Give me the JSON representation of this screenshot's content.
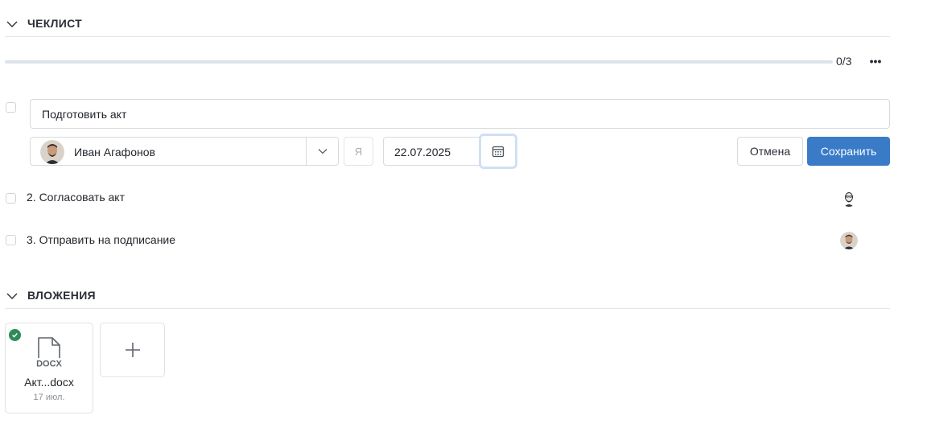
{
  "checklist": {
    "title": "ЧЕКЛИСТ",
    "progress_text": "0/3",
    "progress_fraction": 0,
    "more_icon": "ellipsis-icon",
    "edit_item": {
      "text_value": "Подготовить акт",
      "assignee_name": "Иван Агафонов",
      "me_label": "Я",
      "date_value": "22.07.2025",
      "cancel_label": "Отмена",
      "save_label": "Сохранить"
    },
    "items": [
      {
        "label": "2. Согласовать акт",
        "avatar": "avatar-sketch"
      },
      {
        "label": "3. Отправить на подписание",
        "avatar": "avatar-photo"
      }
    ]
  },
  "attachments": {
    "title": "ВЛОЖЕНИЯ",
    "files": [
      {
        "type_label": "DOCX",
        "name": "Акт...docx",
        "date": "17 июл.",
        "status": "uploaded"
      }
    ],
    "add_icon": "plus-icon"
  },
  "colors": {
    "accent": "#3a7bc8",
    "success": "#2e8b57",
    "border": "#d6dadf"
  }
}
